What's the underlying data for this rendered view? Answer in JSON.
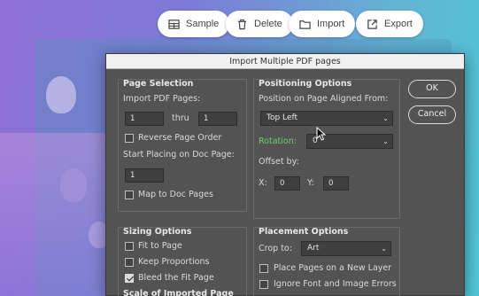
{
  "toolbar": {
    "sample": "Sample",
    "delete": "Delete",
    "import": "Import",
    "export": "Export"
  },
  "dialog": {
    "title": "Import Multiple PDF pages",
    "ok": "OK",
    "cancel": "Cancel",
    "page_selection": {
      "title": "Page Selection",
      "import_label": "Import PDF Pages:",
      "from_value": "1",
      "thru_label": "thru",
      "to_value": "1",
      "reverse_label": "Reverse Page Order",
      "reverse_checked": false,
      "start_label": "Start Placing on Doc Page:",
      "start_value": "1",
      "map_label": "Map to Doc Pages",
      "map_checked": false
    },
    "positioning": {
      "title": "Positioning Options",
      "aligned_label": "Position on Page Aligned From:",
      "aligned_value": "Top Left",
      "rotation_label": "Rotation:",
      "rotation_value": "0",
      "offset_label": "Offset by:",
      "x_label": "X:",
      "x_value": "0",
      "y_label": "Y:",
      "y_value": "0"
    },
    "sizing": {
      "title": "Sizing Options",
      "fit_label": "Fit to Page",
      "fit_checked": false,
      "keep_label": "Keep Proportions",
      "keep_checked": false,
      "bleed_label": "Bleed the Fit Page",
      "bleed_checked": true,
      "scale_label": "Scale of Imported Page"
    },
    "placement": {
      "title": "Placement Options",
      "crop_label": "Crop to:",
      "crop_value": "Art",
      "new_layer_label": "Place Pages on a New Layer",
      "new_layer_checked": false,
      "ignore_label": "Ignore Font and Image Errors",
      "ignore_checked": false
    }
  },
  "colors": {
    "dialog_bg": "#535353",
    "accent_green": "#6fcf6f"
  }
}
